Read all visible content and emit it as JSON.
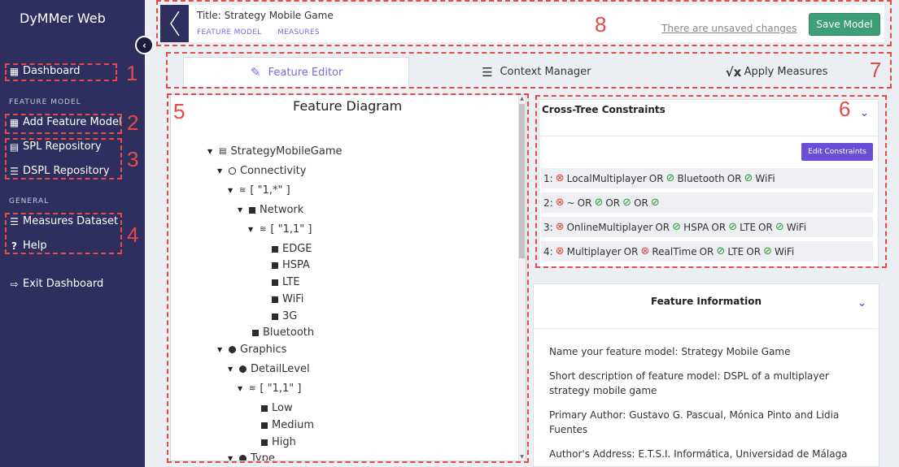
{
  "sidebar": {
    "brand": "DyMMer Web",
    "collapse_icon": "chevron-left-icon",
    "dashboard": "Dashboard",
    "section_feature_model": "FEATURE MODEL",
    "add_feature_model": "Add Feature Model",
    "spl_repository": "SPL Repository",
    "dspl_repository": "DSPL Repository",
    "section_general": "GENERAL",
    "measures_dataset": "Measures Dataset",
    "help": "Help",
    "exit_dashboard": "Exit Dashboard"
  },
  "annotations": [
    "1",
    "2",
    "3",
    "4",
    "5",
    "6",
    "7",
    "8"
  ],
  "header": {
    "title": "Title: Strategy Mobile Game",
    "link_feature_model": "FEATURE MODEL",
    "link_measures": "MEASURES",
    "unsaved": "There are unsaved changes",
    "save_label": "Save Model"
  },
  "tabs": [
    {
      "label": "Feature Editor",
      "icon": "edit-icon"
    },
    {
      "label": "Context Manager",
      "icon": "list-icon"
    },
    {
      "label": "Apply Measures",
      "icon": "sqrt-x-icon"
    }
  ],
  "diagram": {
    "title": "Feature Diagram",
    "nodes": [
      "StrategyMobileGame",
      "Connectivity",
      "[ \"1,*\" ]",
      "Network",
      "[ \"1,1\" ]",
      "EDGE",
      "HSPA",
      "LTE",
      "WiFi",
      "3G",
      "Bluetooth",
      "Graphics",
      "DetailLevel",
      "[ \"1,1\" ]",
      "Low",
      "Medium",
      "High",
      "Type"
    ]
  },
  "constraints": {
    "title": "Cross-Tree Constraints",
    "edit_label": "Edit Constraints",
    "rows": [
      {
        "index": "1:",
        "terms": [
          {
            "icon": "x",
            "text": "LocalMultiplayer"
          },
          {
            "sep": "OR"
          },
          {
            "icon": "ok",
            "text": "Bluetooth"
          },
          {
            "sep": "OR"
          },
          {
            "icon": "ok",
            "text": "WiFi"
          }
        ]
      },
      {
        "index": "2:",
        "terms": [
          {
            "icon": "x",
            "text": "~"
          },
          {
            "sep": "OR"
          },
          {
            "icon": "ok",
            "text": ""
          },
          {
            "sep": "OR"
          },
          {
            "icon": "ok",
            "text": ""
          },
          {
            "sep": "OR"
          },
          {
            "icon": "ok",
            "text": ""
          }
        ]
      },
      {
        "index": "3:",
        "terms": [
          {
            "icon": "x",
            "text": "OnlineMultiplayer"
          },
          {
            "sep": "OR"
          },
          {
            "icon": "ok",
            "text": "HSPA"
          },
          {
            "sep": "OR"
          },
          {
            "icon": "ok",
            "text": "LTE"
          },
          {
            "sep": "OR"
          },
          {
            "icon": "ok",
            "text": "WiFi"
          }
        ]
      },
      {
        "index": "4:",
        "terms": [
          {
            "icon": "x",
            "text": "Multiplayer"
          },
          {
            "sep": "OR"
          },
          {
            "icon": "x",
            "text": "RealTime"
          },
          {
            "sep": "OR"
          },
          {
            "icon": "ok",
            "text": "LTE"
          },
          {
            "sep": "OR"
          },
          {
            "icon": "ok",
            "text": "WiFi"
          }
        ]
      }
    ]
  },
  "info": {
    "title": "Feature Information",
    "name": "Name your feature model: Strategy Mobile Game",
    "description": "Short description of feature model: DSPL of a multiplayer strategy mobile game",
    "author": "Primary Author: Gustavo G. Pascual, Mónica Pinto and Lidia Fuentes",
    "address": "Author's Address: E.T.S.I. Informática, Universidad de Málaga"
  },
  "colors": {
    "sidebar_bg": "#2e2f5e",
    "accent": "#7a68d4",
    "save_green": "#3d9e78",
    "annotation_red": "#e34b48"
  }
}
